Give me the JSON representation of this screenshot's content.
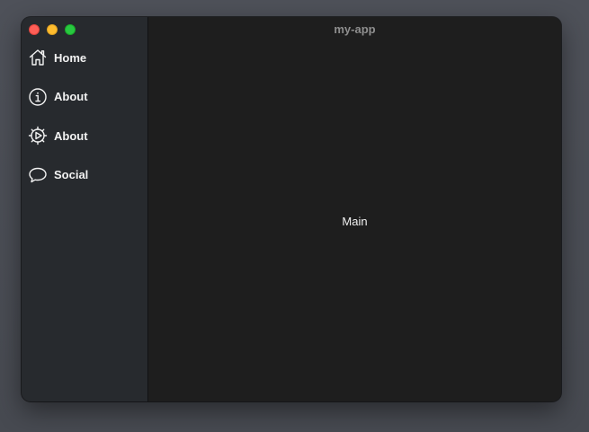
{
  "window": {
    "title": "my-app"
  },
  "sidebar": {
    "items": [
      {
        "label": "Home",
        "icon": "home-icon"
      },
      {
        "label": "About",
        "icon": "info-icon"
      },
      {
        "label": "About",
        "icon": "settings-icon"
      },
      {
        "label": "Social",
        "icon": "chat-bubble-icon"
      }
    ]
  },
  "main": {
    "label": "Main"
  },
  "colors": {
    "sidebar_bg": "#272a2e",
    "main_bg": "#1e1e1e",
    "close": "#fe5f57",
    "minimize": "#febc2e",
    "maximize": "#28c840",
    "text": "#f2f2f2"
  }
}
